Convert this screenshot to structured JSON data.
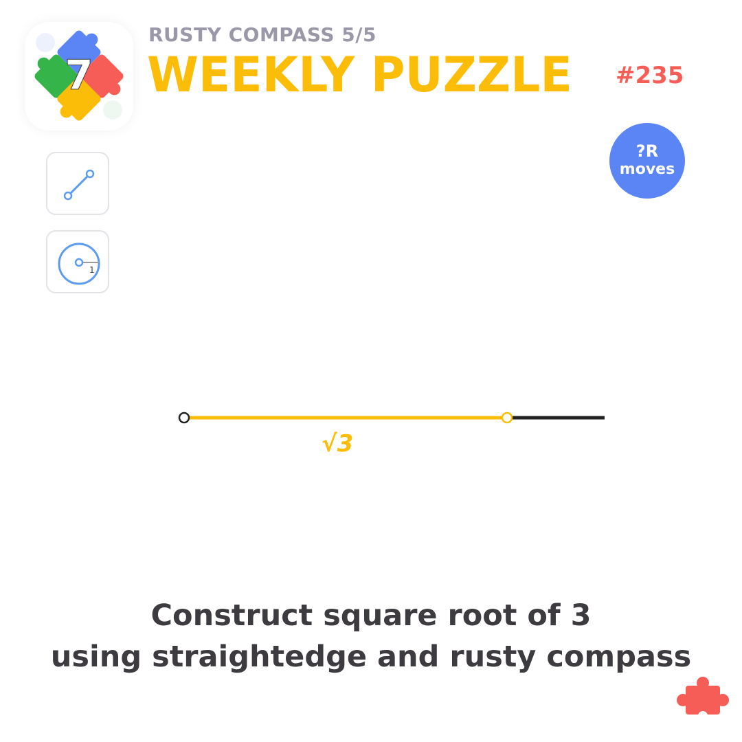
{
  "header": {
    "subtitle": "RUSTY COMPASS 5/5",
    "title": "WEEKLY PUZZLE",
    "puzzle_number": "#235",
    "logo_digit": "7"
  },
  "moves_badge": {
    "line1": "?R",
    "line2": "moves"
  },
  "tools": [
    {
      "name": "straightedge",
      "icon": "line-segment-icon"
    },
    {
      "name": "rusty-compass",
      "icon": "compass-circle-icon",
      "radius_label": "1"
    }
  ],
  "board": {
    "segment_label": "√3"
  },
  "instructions": {
    "line1": "Construct square root of 3",
    "line2": "using straightedge and rusty compass"
  },
  "colors": {
    "accent_yellow": "#fbbd08",
    "accent_red": "#f65d57",
    "accent_blue": "#5b85f4",
    "text_dark": "#3d3b40",
    "text_gray": "#9a98a8",
    "logo_green": "#35b44a",
    "logo_red": "#f65d57",
    "logo_blue": "#5b85f4",
    "logo_yellow": "#fbbd08"
  }
}
